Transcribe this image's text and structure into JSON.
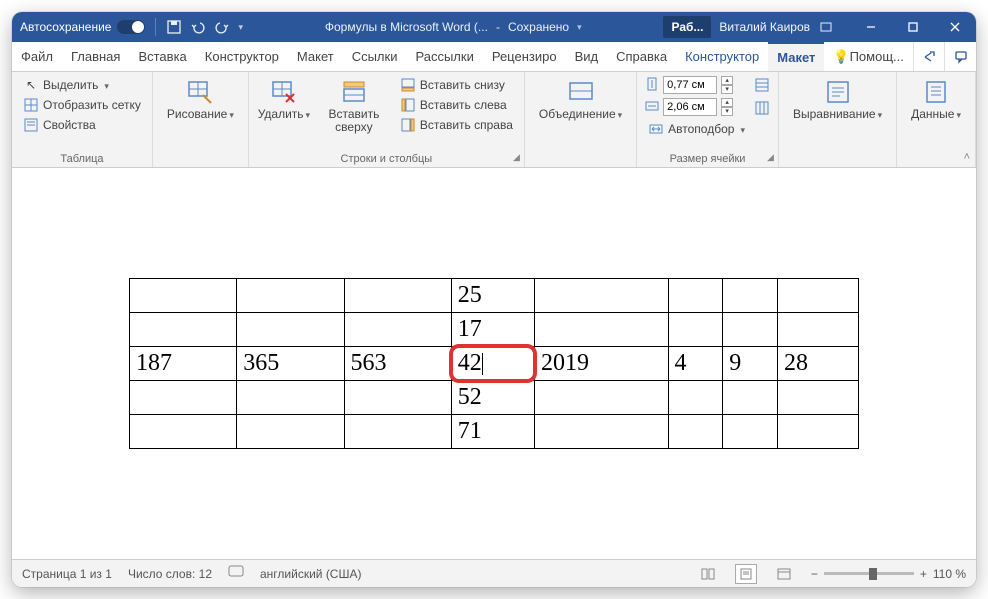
{
  "titlebar": {
    "autosave": "Автосохранение",
    "doc_title": "Формулы в Microsoft Word (...",
    "saved": "Сохранено",
    "doc_tab": "Раб...",
    "user": "Виталий Каиров"
  },
  "tabs": {
    "file": "Файл",
    "home": "Главная",
    "insert": "Вставка",
    "design": "Конструктор",
    "layout": "Макет",
    "references": "Ссылки",
    "mailings": "Рассылки",
    "review": "Рецензиро",
    "view": "Вид",
    "help": "Справка",
    "table_design": "Конструктор",
    "table_layout": "Макет",
    "tell_me": "Помощ..."
  },
  "ribbon": {
    "table_group": "Таблица",
    "select": "Выделить",
    "gridlines": "Отобразить сетку",
    "properties": "Свойства",
    "draw_group": "Рисование",
    "draw": "Рисование",
    "delete": "Удалить",
    "rows_cols_group": "Строки и столбцы",
    "insert_above": "Вставить сверху",
    "insert_below": "Вставить снизу",
    "insert_left": "Вставить слева",
    "insert_right": "Вставить справа",
    "merge_group": "Объединение",
    "merge": "Объединение",
    "cell_size_group": "Размер ячейки",
    "height": "0,77 см",
    "width": "2,06 см",
    "autofit": "Автоподбор",
    "alignment_group": "Выравнивание",
    "alignment": "Выравнивание",
    "data_group": "Данные",
    "data": "Данные"
  },
  "table": {
    "rows": [
      [
        "",
        "",
        "",
        "25",
        "",
        "",
        "",
        ""
      ],
      [
        "",
        "",
        "",
        "17",
        "",
        "",
        "",
        ""
      ],
      [
        "187",
        "365",
        "563",
        "42",
        "2019",
        "4",
        "9",
        "28"
      ],
      [
        "",
        "",
        "",
        "52",
        "",
        "",
        "",
        ""
      ],
      [
        "",
        "",
        "",
        "71",
        "",
        "",
        "",
        ""
      ]
    ],
    "selected": [
      2,
      3
    ]
  },
  "status": {
    "page": "Страница 1 из 1",
    "words": "Число слов: 12",
    "lang": "английский (США)",
    "zoom": "110 %"
  }
}
